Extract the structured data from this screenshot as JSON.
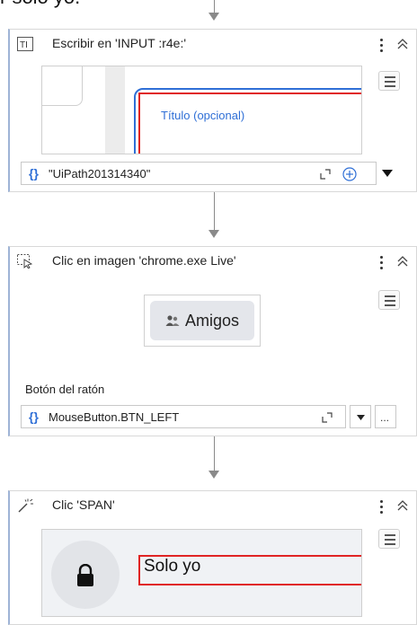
{
  "top_fragment": "r solo yo.",
  "cards": [
    {
      "title": "Escribir en 'INPUT  :r4e:'",
      "icon": "type-into-icon",
      "screenshot_text": "Título (opcional)",
      "input_value": "\"UiPath201314340\""
    },
    {
      "title": "Clic en imagen 'chrome.exe Live'",
      "icon": "click-image-icon",
      "screenshot_text": "Amigos",
      "field_label": "Botón del ratón",
      "input_value": "MouseButton.BTN_LEFT",
      "more_label": "..."
    },
    {
      "title": "Clic 'SPAN'",
      "icon": "click-wand-icon",
      "screenshot_text": "Solo yo"
    }
  ],
  "colors": {
    "accent_blue": "#2f6fd6",
    "highlight_red": "#e02424",
    "card_left_border": "#9fb4d6",
    "connector": "#8a8a8a"
  }
}
